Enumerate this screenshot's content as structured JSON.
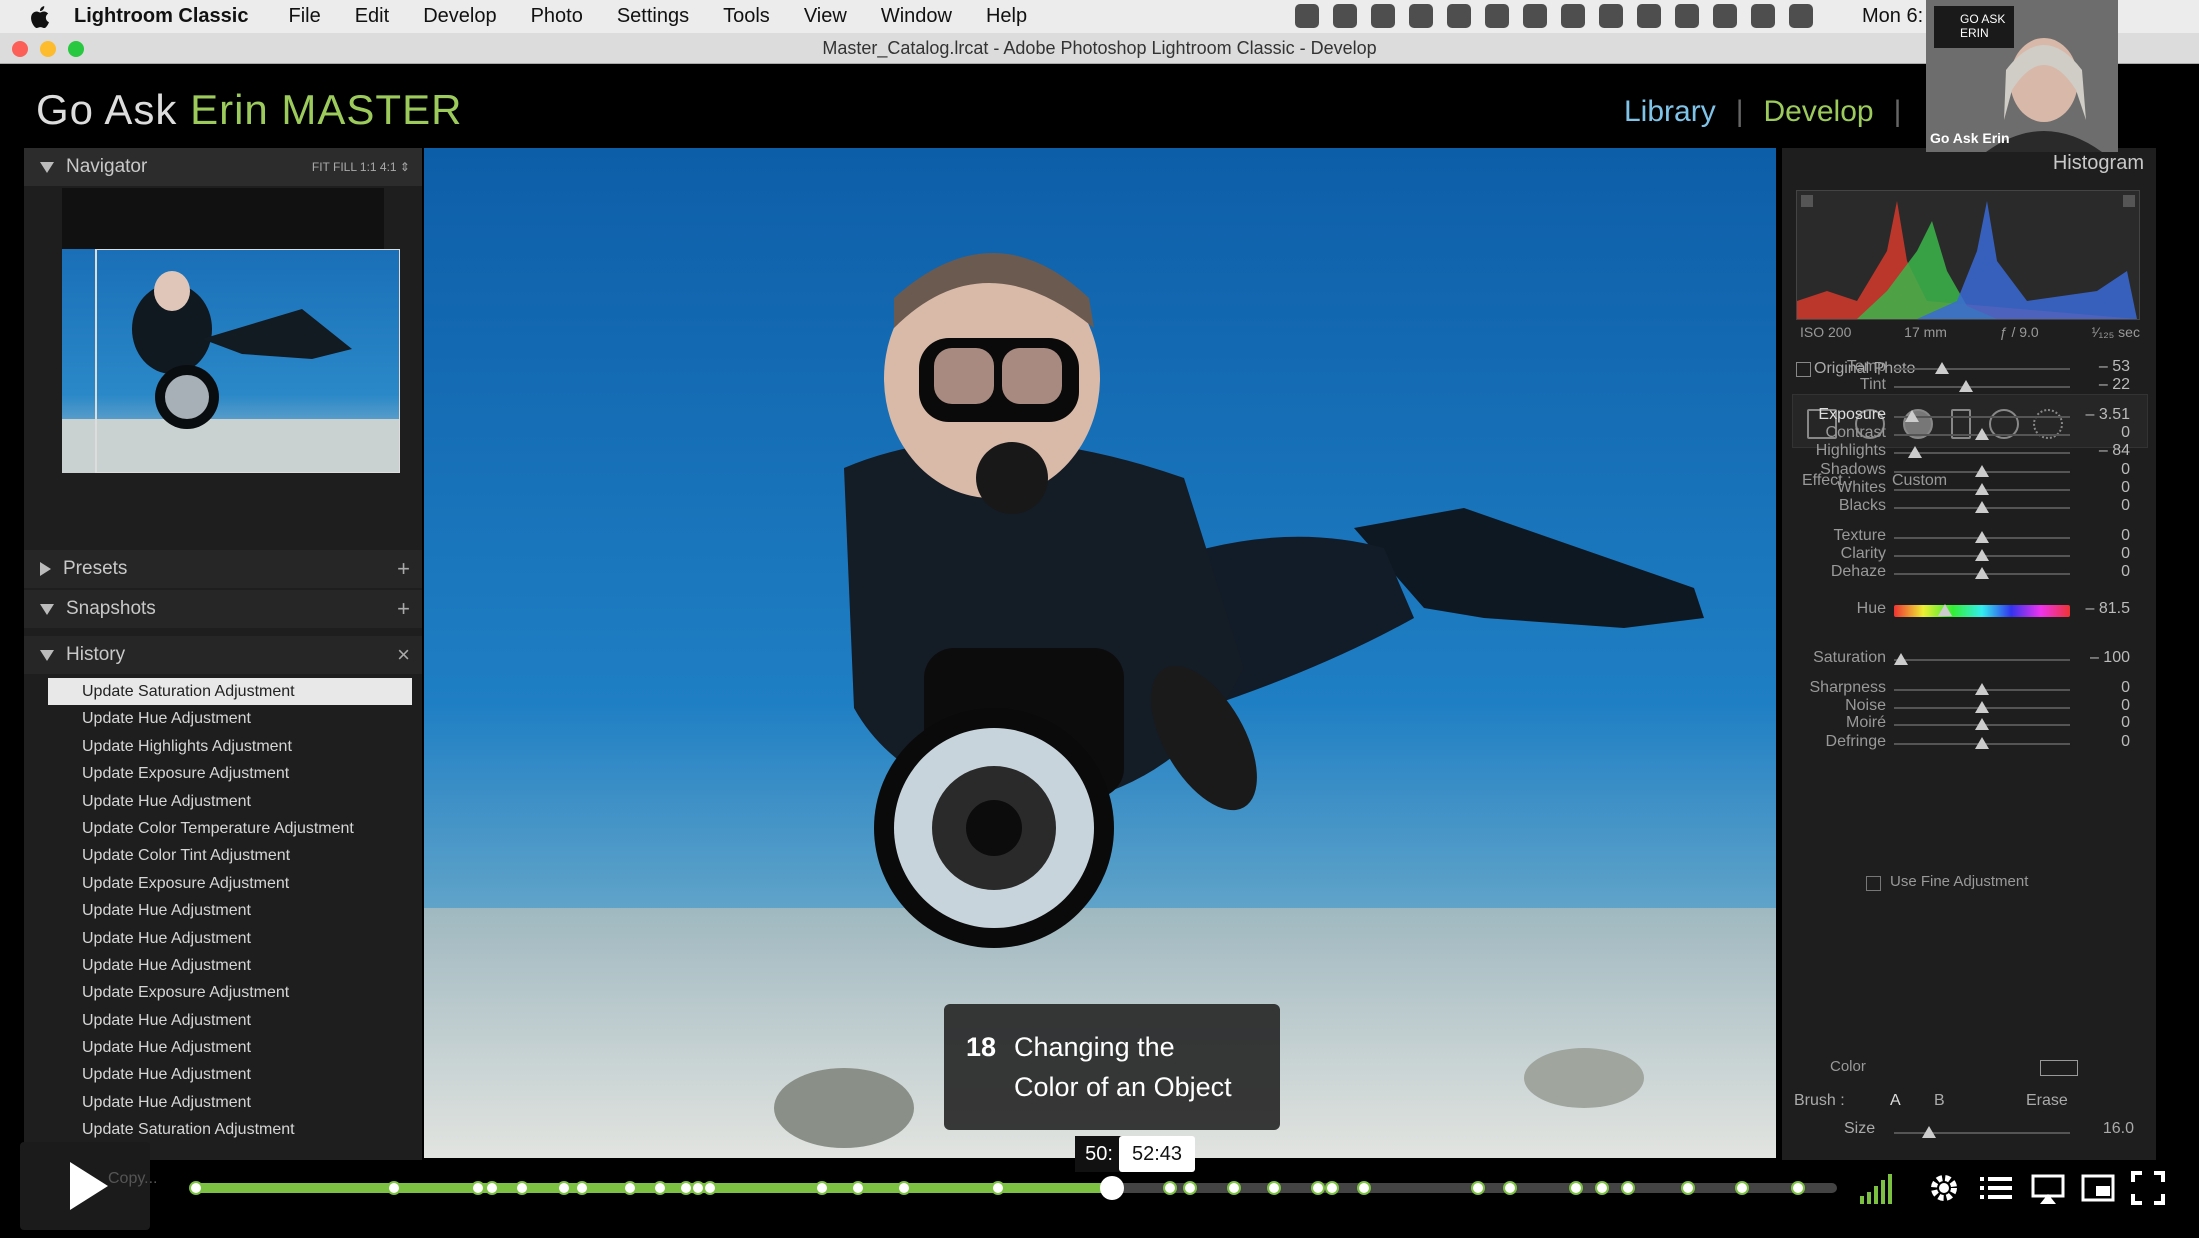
{
  "menubar": {
    "app": "Lightroom Classic",
    "items": [
      "File",
      "Edit",
      "Develop",
      "Photo",
      "Settings",
      "Tools",
      "View",
      "Window",
      "Help"
    ],
    "clock": "Mon 6:"
  },
  "window": {
    "title": "Master_Catalog.lrcat - Adobe Photoshop Lightroom Classic - Develop"
  },
  "identity": {
    "prefix": "Go Ask ",
    "accent": "Erin MASTER"
  },
  "modules": {
    "library": "Library",
    "sep": "|",
    "develop": "Develop",
    "sep2": "|"
  },
  "navigator": {
    "title": "Navigator",
    "zoom": "FIT  FILL  1:1  4:1 ⇕"
  },
  "presets": {
    "title": "Presets",
    "add": "+"
  },
  "snapshots": {
    "title": "Snapshots",
    "add": "+"
  },
  "history": {
    "title": "History",
    "clear": "×",
    "items": [
      "Update Saturation Adjustment",
      "Update Hue Adjustment",
      "Update Highlights Adjustment",
      "Update Exposure Adjustment",
      "Update Hue Adjustment",
      "Update Color Temperature Adjustment",
      "Update Color Tint Adjustment",
      "Update Exposure Adjustment",
      "Update Hue Adjustment",
      "Update Hue Adjustment",
      "Update Hue Adjustment",
      "Update Exposure Adjustment",
      "Update Hue Adjustment",
      "Update Hue Adjustment",
      "Update Hue Adjustment",
      "Update Hue Adjustment",
      "Update Saturation Adjustment"
    ]
  },
  "caption": {
    "number": "18",
    "line1": "Changing the",
    "line2": "Color of an Object"
  },
  "histogram": {
    "title": "Histogram",
    "iso": "ISO 200",
    "focal": "17 mm",
    "aperture": "ƒ / 9.0",
    "shutter": "¹⁄₁₂₅ sec",
    "original": "Original Photo"
  },
  "mask": {
    "effect_label": "Effect :",
    "effect_value": "Custom",
    "sliders": [
      {
        "label": "Temp",
        "value": "– 53",
        "level": 0.27
      },
      {
        "label": "Tint",
        "value": "– 22",
        "level": 0.41
      },
      {
        "label": "Exposure",
        "value": "– 3.51",
        "level": 0.1
      },
      {
        "label": "Contrast",
        "value": "0",
        "level": 0.5
      },
      {
        "label": "Highlights",
        "value": "– 84",
        "level": 0.12
      },
      {
        "label": "Shadows",
        "value": "0",
        "level": 0.5
      },
      {
        "label": "Whites",
        "value": "0",
        "level": 0.5
      },
      {
        "label": "Blacks",
        "value": "0",
        "level": 0.5
      },
      {
        "label": "Texture",
        "value": "0",
        "level": 0.5
      },
      {
        "label": "Clarity",
        "value": "0",
        "level": 0.5
      },
      {
        "label": "Dehaze",
        "value": "0",
        "level": 0.5
      },
      {
        "label": "Hue",
        "value": "– 81.5",
        "level": 0.29
      },
      {
        "label": "Saturation",
        "value": "– 100",
        "level": 0.04
      },
      {
        "label": "Sharpness",
        "value": "0",
        "level": 0.5
      },
      {
        "label": "Noise",
        "value": "0",
        "level": 0.5
      },
      {
        "label": "Moiré",
        "value": "0",
        "level": 0.5
      },
      {
        "label": "Defringe",
        "value": "0",
        "level": 0.5
      }
    ],
    "fine_adjust": "Use Fine Adjustment",
    "color_label": "Color",
    "brush_label": "Brush :",
    "brush_a": "A",
    "brush_b": "B",
    "brush_erase": "Erase",
    "size_label": "Size",
    "size_value": "16.0",
    "size_level": 0.2
  },
  "presenter": {
    "badge": "GO ASK ERIN",
    "name": "Go Ask Erin"
  },
  "player": {
    "tooltip_left": "50:",
    "tooltip_time": "52:43",
    "progress": 0.56,
    "bottom_left_label": "Copy..."
  }
}
